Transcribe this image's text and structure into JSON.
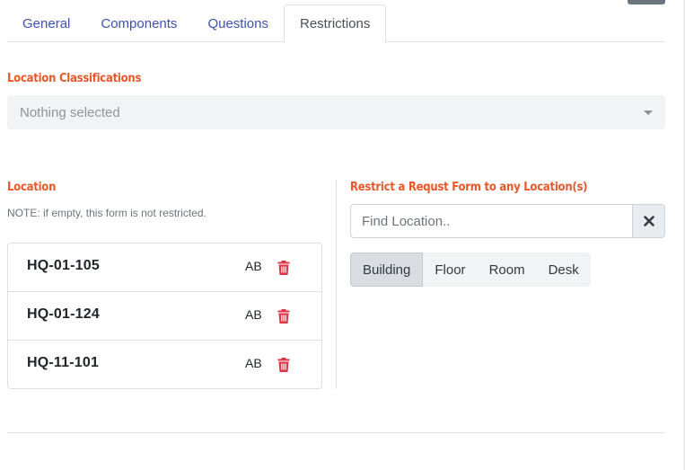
{
  "tabs": [
    {
      "label": "General"
    },
    {
      "label": "Components"
    },
    {
      "label": "Questions"
    },
    {
      "label": "Restrictions"
    }
  ],
  "classification": {
    "label": "Location Classifications",
    "select_value": "Nothing selected"
  },
  "location": {
    "label": "Location",
    "note": "NOTE: if empty, this form is not restricted.",
    "items": [
      {
        "name": "HQ-01-105",
        "code": "AB"
      },
      {
        "name": "HQ-01-124",
        "code": "AB"
      },
      {
        "name": "HQ-11-101",
        "code": "AB"
      }
    ]
  },
  "restrict": {
    "label": "Restrict a Requst Form to any Location(s)",
    "placeholder": "Find Location..",
    "filters": [
      {
        "label": "Building"
      },
      {
        "label": "Floor"
      },
      {
        "label": "Room"
      },
      {
        "label": "Desk"
      }
    ]
  },
  "colors": {
    "accent_label": "#e8572a",
    "tab_link": "#3f51b5",
    "trash": "#dc3545"
  },
  "icons": {
    "trash": "trash-icon",
    "close": "close-icon",
    "dropdown": "caret-down-icon"
  }
}
